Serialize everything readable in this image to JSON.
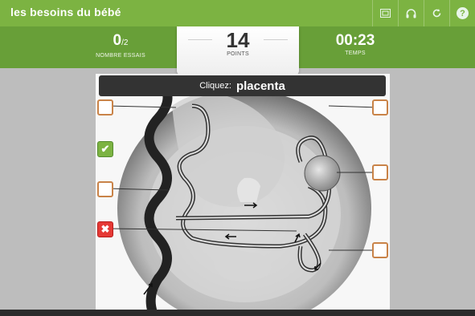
{
  "app": {
    "title": "les besoins du bébé"
  },
  "toolbar": {
    "icons": [
      "screen-icon",
      "headphones-icon",
      "restart-icon",
      "help-icon"
    ],
    "help_glyph": "?"
  },
  "stats": {
    "tries_value": "0",
    "tries_total": "/2",
    "tries_label": "NOMBRE ESSAIS",
    "points_value": "14",
    "points_label": "POINTS",
    "time_value": "00:23",
    "time_label": "TEMPS"
  },
  "prompt": {
    "label": "Cliquez:",
    "target": "placenta"
  },
  "markers": {
    "correct": "✔",
    "wrong": "✖"
  },
  "colors": {
    "green": "#7cb342",
    "dark_green": "#689f38",
    "box_border": "#c98348",
    "error": "#e53935"
  }
}
